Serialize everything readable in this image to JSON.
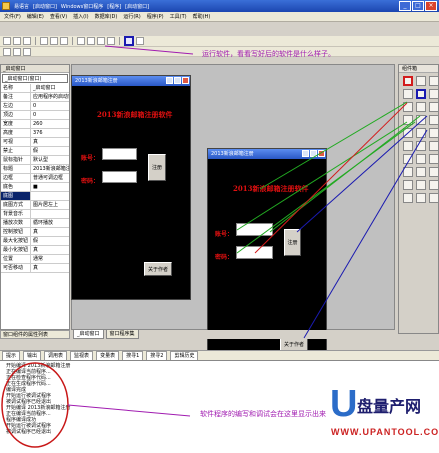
{
  "window": {
    "title_parts": [
      "易语言",
      "[启动窗口]",
      "Windows窗口程序",
      "[程序]",
      "[启动窗口]"
    ]
  },
  "menu": [
    "文件(F)",
    "编辑(E)",
    "查看(V)",
    "插入(I)",
    "数据库(D)",
    "运行(R)",
    "程序(P)",
    "工具(T)",
    "帮助(H)"
  ],
  "annotations": {
    "run_tip": "运行软件，看看写好后的软件是什么样子。",
    "output_tip": "软件程序的编写和调试会在这里显示出来"
  },
  "left_panel": {
    "header": "_启动窗口",
    "select": "_启动窗口(窗口)",
    "properties": [
      {
        "k": "名称",
        "v": "_启动窗口"
      },
      {
        "k": "备注",
        "v": "应用程序的启动窗口"
      },
      {
        "k": "左边",
        "v": "0"
      },
      {
        "k": "顶边",
        "v": "0"
      },
      {
        "k": "宽度",
        "v": "260"
      },
      {
        "k": "高度",
        "v": "376"
      },
      {
        "k": "可视",
        "v": "真"
      },
      {
        "k": "禁止",
        "v": "假"
      },
      {
        "k": "鼠标指针",
        "v": "默认型"
      },
      {
        "k": "标题",
        "v": "2013新浪邮箱注册"
      },
      {
        "k": "边框",
        "v": "普通可调边框"
      },
      {
        "k": "底色",
        "v": "■"
      },
      {
        "k": "底图",
        "v": ""
      },
      {
        "k": "底图方式",
        "v": "图片居左上"
      },
      {
        "k": "背景音乐",
        "v": ""
      },
      {
        "k": "播放次数",
        "v": "循环播放"
      },
      {
        "k": "控制按钮",
        "v": "真"
      },
      {
        "k": "最大化按钮",
        "v": "假"
      },
      {
        "k": "最小化按钮",
        "v": "真"
      },
      {
        "k": "位置",
        "v": "通常"
      },
      {
        "k": "可否移动",
        "v": "真"
      }
    ],
    "status": "窗口组件的属性列表"
  },
  "form1": {
    "title": "2013新浪邮箱注册",
    "heading": "2013新浪邮箱注册软件",
    "account_label": "账号：",
    "password_label": "密码：",
    "register_button": "注册",
    "about_button": "关于作者"
  },
  "form2": {
    "title": "2013新浪邮箱注册",
    "heading": "2013新浪邮箱注册软件",
    "account_label": "账号：",
    "password_label": "密码：",
    "register_button": "注册",
    "about_button": "关于作者"
  },
  "right_panel": {
    "title": "组件箱"
  },
  "desk_tabs": [
    "_启动窗口",
    "窗口程序集"
  ],
  "bottom_tabs": [
    "提示",
    "输出",
    "调用表",
    "监视表",
    "变量表",
    "搜寻1",
    "搜寻2",
    "剪辑历史"
  ],
  "output_lines": [
    "开始编译 2013新浪邮箱注册",
    "正在编译当前程序...",
    "正在检查程序代码...",
    "正在生成程序代码...",
    "编译完成",
    "开始运行被调试程序",
    "被调试程序已经退出",
    "开始编译 2013新浪邮箱注册",
    "正在编译当前程序...",
    "程序编译成功",
    "开始运行被调试程序",
    "被调试程序已经退出"
  ],
  "watermark": {
    "brand": "盘量产网",
    "url": "WWW.UPANTOOL.COM"
  },
  "colors": {
    "form_bg": "#000000",
    "heading_red": "#e01010",
    "annotation_purple": "#a01bb0",
    "arrow_green": "#22aa22",
    "arrow_blue": "#1a1ab0",
    "arrow_red": "#d21c1c"
  },
  "icons": [
    "app-icon",
    "pointer-icon",
    "label-icon",
    "button-icon",
    "edit-icon",
    "picture-icon",
    "run-icon"
  ]
}
